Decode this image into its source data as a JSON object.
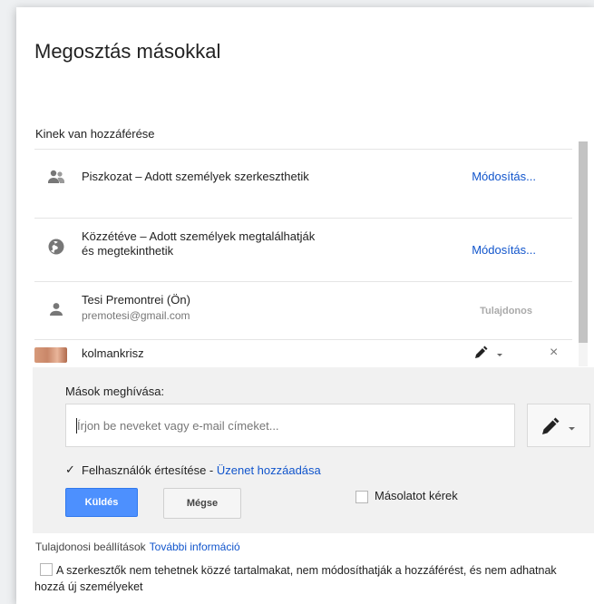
{
  "dialog": {
    "title": "Megosztás másokkal",
    "access_label": "Kinek van hozzáférése"
  },
  "access_rows": [
    {
      "icon": "people-icon",
      "title": "Piszkozat – Adott személyek szerkeszthetik",
      "action": "Módosítás..."
    },
    {
      "icon": "globe-icon",
      "title_line1": "Közzétéve – Adott személyek megtalálhatják",
      "title_line2": "és megtekinthetik",
      "action": "Módosítás..."
    },
    {
      "icon": "person-icon",
      "name": "Tesi Premontrei (Ön)",
      "email": "premotesi@gmail.com",
      "role": "Tulajdonos"
    },
    {
      "icon": "avatar-photo",
      "name": "kolmankrisz",
      "permission_icon": "pencil-icon",
      "remove_icon": "close-icon"
    }
  ],
  "invite": {
    "label": "Mások meghívása:",
    "placeholder": "Írjon be neveket vagy e-mail címeket...",
    "value": "",
    "permission_icon": "pencil-icon",
    "notify_checked": true,
    "notify_label": "Felhasználók értesítése - ",
    "add_message_link": "Üzenet hozzáadása",
    "send_label": "Küldés",
    "cancel_label": "Mégse",
    "copy_checked": false,
    "copy_label": "Másolatot kérek"
  },
  "owner_settings": {
    "label": "Tulajdonosi beállítások",
    "more_link": "További információ",
    "restrict_checked": false,
    "restrict_label": "A szerkesztők nem tehetnek közzé tartalmakat, nem módosíthatják a hozzáférést, és nem adhatnak hozzá új személyeket"
  },
  "colors": {
    "accent": "#4d90fe",
    "link": "#1155cc"
  }
}
